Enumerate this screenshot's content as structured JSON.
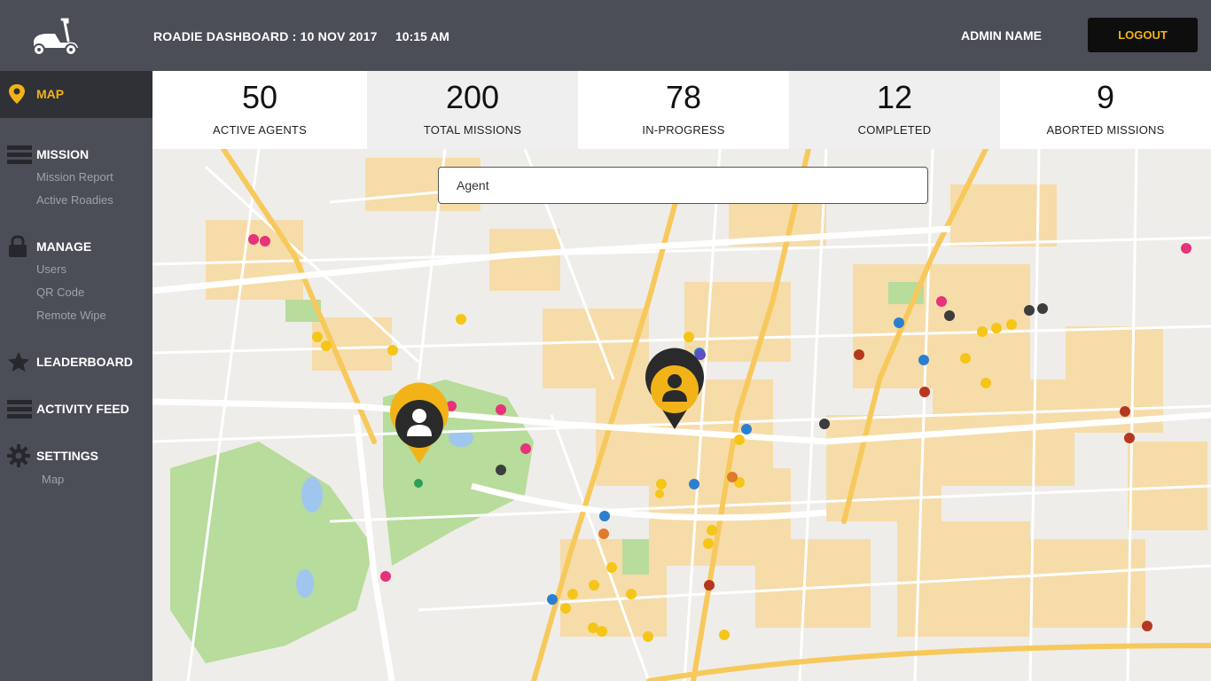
{
  "header": {
    "title": "ROADIE DASHBOARD : 10 NOV 2017",
    "time": "10:15 AM",
    "admin_name": "ADMIN NAME",
    "logout_label": "LOGOUT"
  },
  "sidebar": {
    "map": "MAP",
    "mission": {
      "label": "MISSION",
      "items": [
        "Mission Report",
        "Active Roadies"
      ]
    },
    "manage": {
      "label": "MANAGE",
      "items": [
        "Users",
        "QR Code",
        "Remote Wipe"
      ]
    },
    "leaderboard": "LEADERBOARD",
    "activity_feed": "ACTIVITY FEED",
    "settings": {
      "label": "SETTINGS",
      "items": [
        "Map"
      ]
    }
  },
  "stats": [
    {
      "value": "50",
      "label": "ACTIVE AGENTS"
    },
    {
      "value": "200",
      "label": "TOTAL MISSIONS"
    },
    {
      "value": "78",
      "label": "IN-PROGRESS"
    },
    {
      "value": "12",
      "label": "COMPLETED"
    },
    {
      "value": "9",
      "label": "ABORTED MISSIONS"
    }
  ],
  "search": {
    "placeholder": "Agent"
  },
  "colors": {
    "accent": "#f2b318",
    "sidebar": "#4b4e57",
    "sidebar_active": "#2f3137",
    "park": "#b7dc9b",
    "district": "#f6dca9"
  }
}
